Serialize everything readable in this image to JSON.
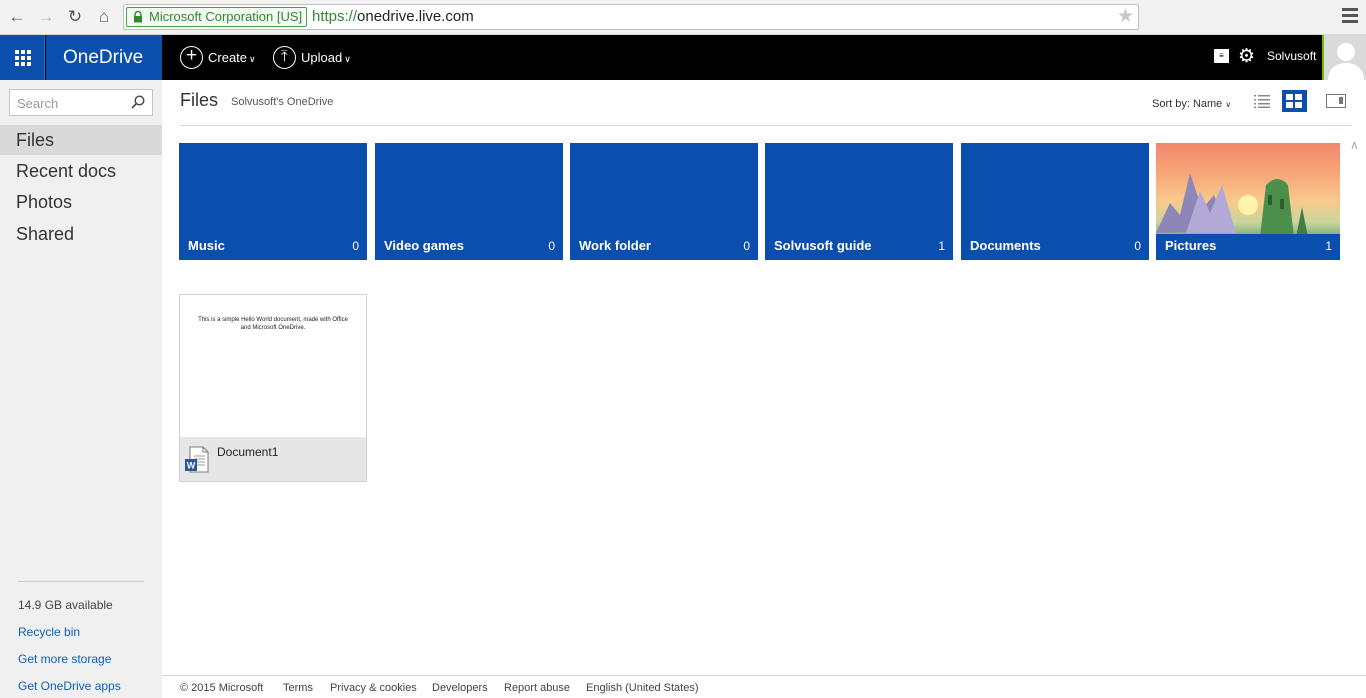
{
  "browser": {
    "ev_cert": "Microsoft Corporation [US]",
    "url_scheme": "https://",
    "url_host": "onedrive.live.com"
  },
  "appbar": {
    "brand": "OneDrive",
    "create_label": "Create",
    "upload_label": "Upload",
    "user_name": "Solvusoft"
  },
  "sidebar": {
    "search_placeholder": "Search",
    "items": [
      {
        "label": "Files",
        "active": true
      },
      {
        "label": "Recent docs"
      },
      {
        "label": "Photos"
      },
      {
        "label": "Shared"
      }
    ],
    "storage": "14.9 GB available",
    "links": [
      "Recycle bin",
      "Get more storage",
      "Get OneDrive apps"
    ]
  },
  "main": {
    "title": "Files",
    "breadcrumb": "Solvusoft's OneDrive",
    "sort_label": "Sort by: Name",
    "folders": [
      {
        "name": "Music",
        "count": "0"
      },
      {
        "name": "Video games",
        "count": "0"
      },
      {
        "name": "Work folder",
        "count": "0"
      },
      {
        "name": "Solvusoft guide",
        "count": "1"
      },
      {
        "name": "Documents",
        "count": "0"
      },
      {
        "name": "Pictures",
        "count": "1"
      }
    ],
    "document": {
      "name": "Document1",
      "preview_text": "This is a simple Hello World document, made with Office and Microsoft OneDrive."
    }
  },
  "footer": {
    "copyright": "© 2015 Microsoft",
    "links": [
      "Terms",
      "Privacy & cookies",
      "Developers",
      "Report abuse",
      "English (United States)"
    ]
  },
  "colors": {
    "accent": "#0a4fad",
    "appbar": "#000000",
    "sidebar": "#f0f0f0"
  }
}
